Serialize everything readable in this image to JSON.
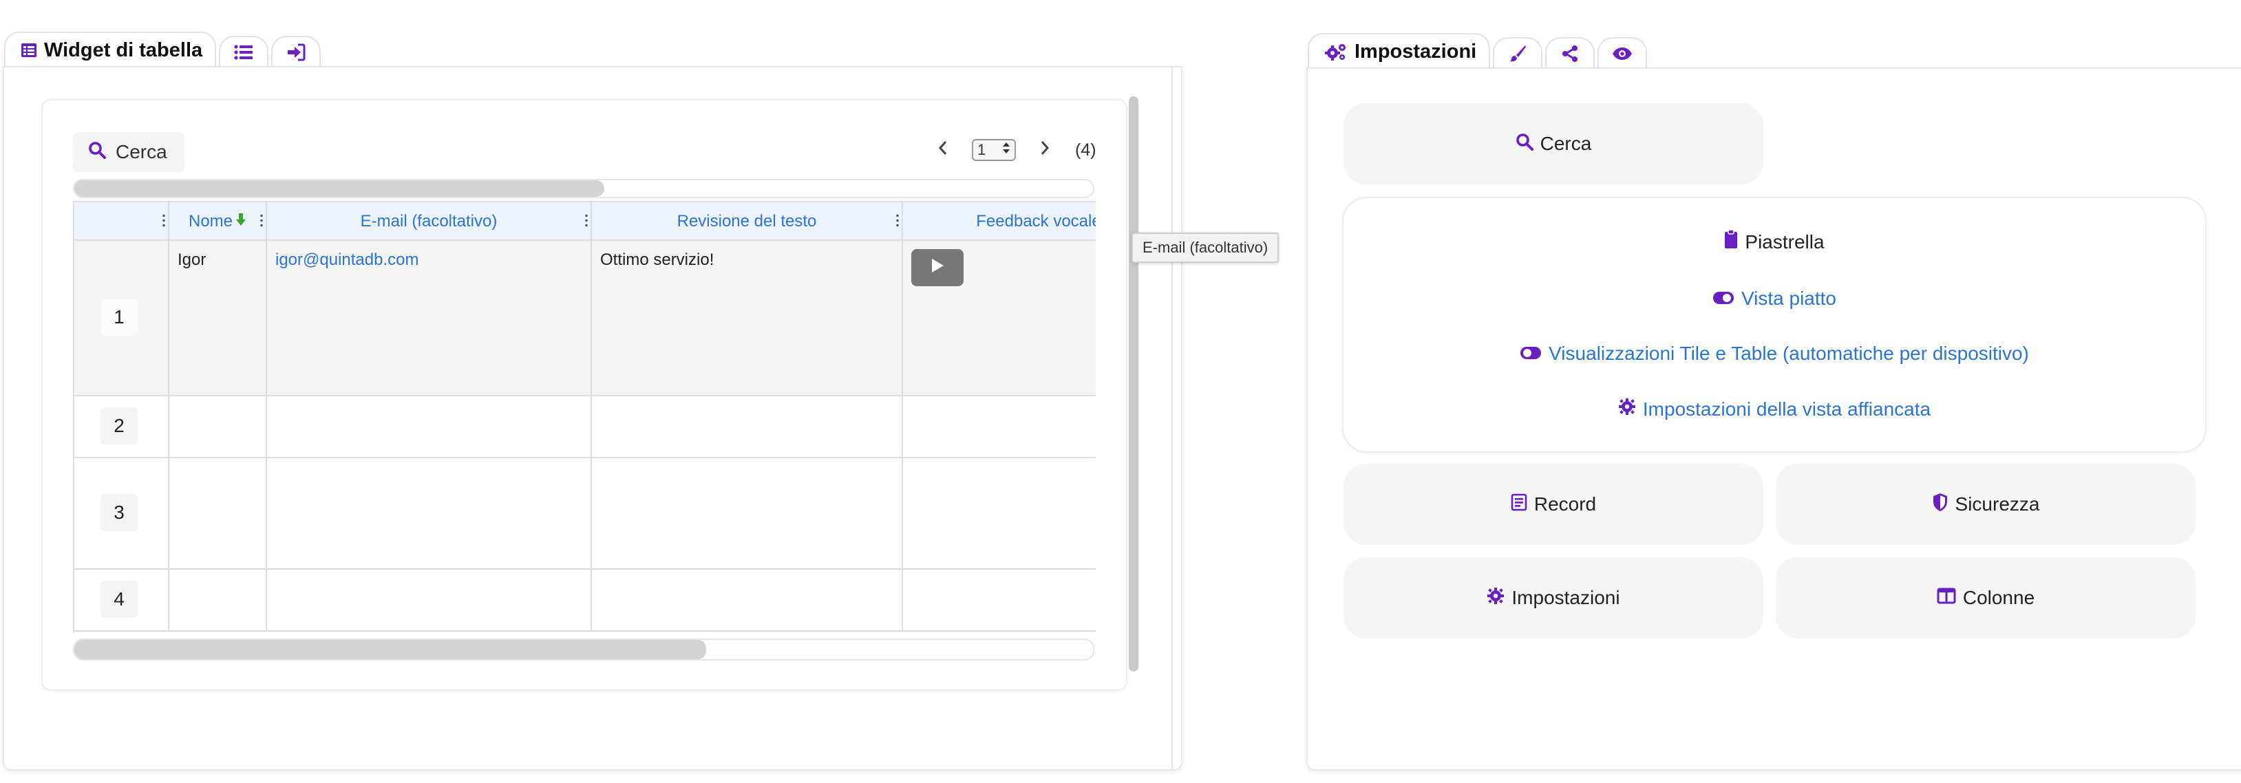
{
  "left_tabs": {
    "active_label": "Widget di tabella",
    "icons": [
      "table-icon",
      "list-icon",
      "sign-in-icon"
    ]
  },
  "right_tabs": {
    "active_label": "Impostazioni",
    "icons": [
      "cogs-icon",
      "brush-icon",
      "share-icon",
      "eye-icon"
    ]
  },
  "table_widget": {
    "search_label": "Cerca",
    "pager": {
      "page": "1",
      "count": "(4)"
    },
    "columns": [
      "Nome",
      "E-mail (facoltativo)",
      "Revisione del testo",
      "Feedback vocale"
    ],
    "rows": [
      {
        "num": "1",
        "nome": "Igor",
        "email": "igor@quintadb.com",
        "review": "Ottimo servizio!"
      },
      {
        "num": "2",
        "nome": "",
        "email": "",
        "review": ""
      },
      {
        "num": "3",
        "nome": "",
        "email": "",
        "review": ""
      },
      {
        "num": "4",
        "nome": "",
        "email": "",
        "review": ""
      }
    ],
    "tooltip": "E-mail (facoltativo)"
  },
  "settings": {
    "search_label": "Cerca",
    "tile_title": "Piastrella",
    "flat_view": "Vista piatto",
    "tile_table_views": "Visualizzazioni Tile e Table (automatiche per dispositivo)",
    "tile_settings": "Impostazioni della vista affiancata",
    "record": "Record",
    "security": "Sicurezza",
    "settings": "Impostazioni",
    "columns": "Colonne"
  },
  "colors": {
    "accent": "#6a1fc2",
    "link": "#2a74d6",
    "sort_arrow": "#3aa335"
  }
}
